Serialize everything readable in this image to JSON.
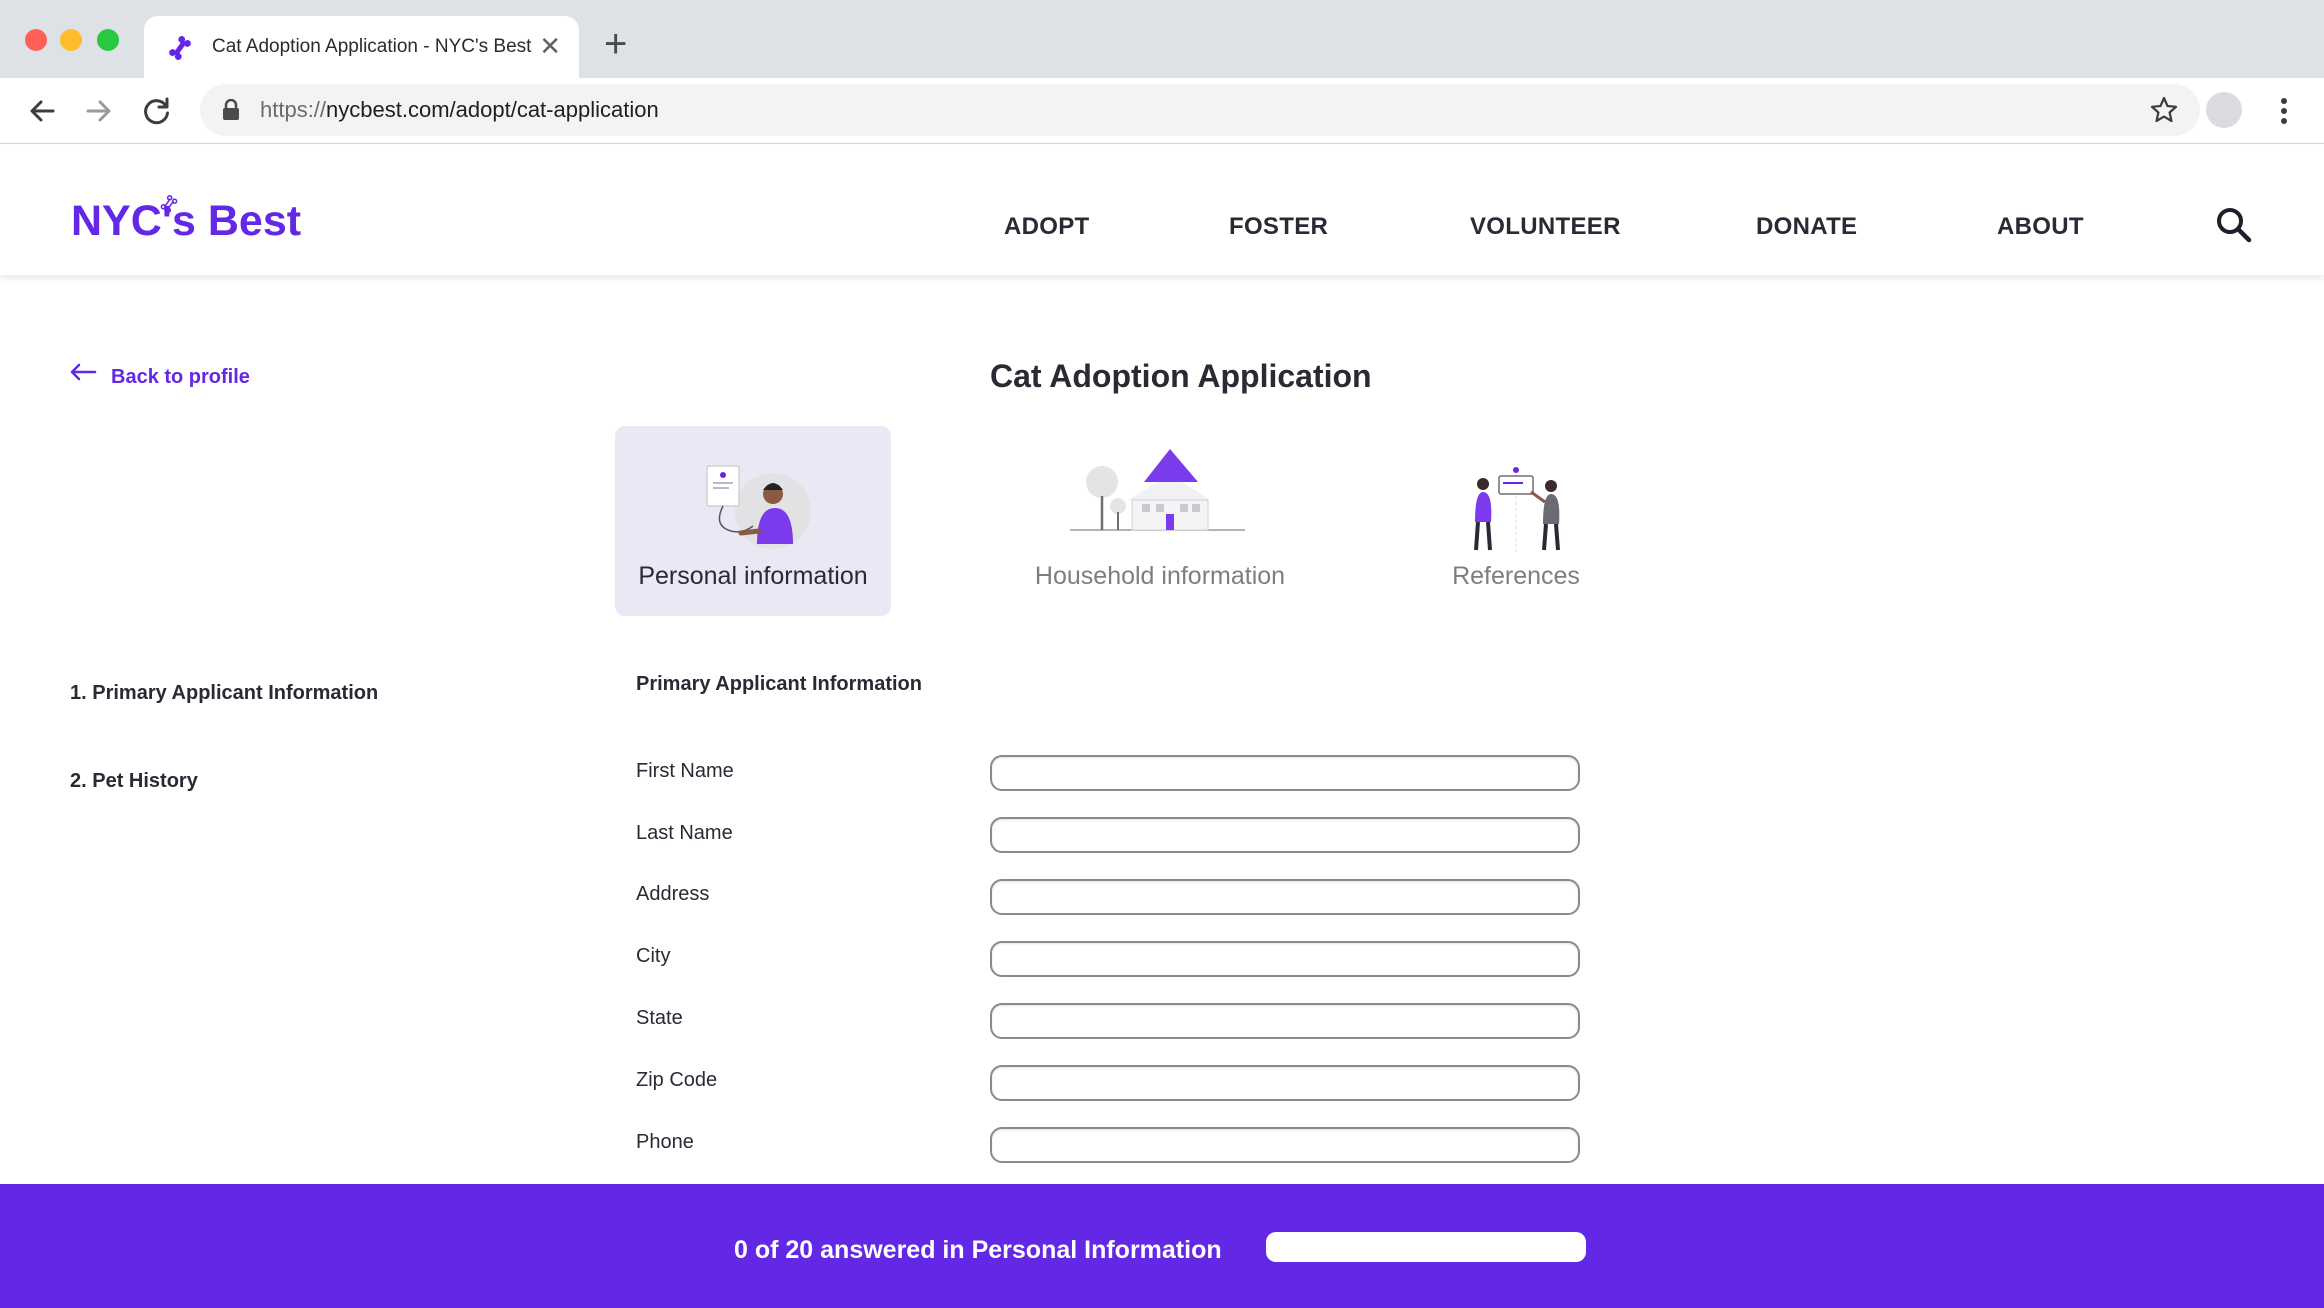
{
  "browser": {
    "tab_title": "Cat Adoption Application - NYC's Best",
    "url_scheme": "https://",
    "url_rest": "nycbest.com/adopt/cat-application",
    "icons": [
      "back-arrow-icon",
      "forward-arrow-icon",
      "reload-icon",
      "lock-icon",
      "star-icon",
      "more-menu-icon",
      "close-icon",
      "plus-icon"
    ]
  },
  "header": {
    "logo": "NYC's Best",
    "nav": [
      "ADOPT",
      "FOSTER",
      "VOLUNTEER",
      "DONATE",
      "ABOUT"
    ]
  },
  "back_link": "Back to profile",
  "page_title": "Cat Adoption Application",
  "steps": [
    {
      "label": "Personal information",
      "active": true
    },
    {
      "label": "Household information",
      "active": false
    },
    {
      "label": "References",
      "active": false
    }
  ],
  "side_nav": [
    "1. Primary Applicant Information",
    "2. Pet History"
  ],
  "form": {
    "section_heading": "Primary Applicant Information",
    "fields": [
      {
        "label": "First Name",
        "value": ""
      },
      {
        "label": "Last Name",
        "value": ""
      },
      {
        "label": "Address",
        "value": ""
      },
      {
        "label": "City",
        "value": ""
      },
      {
        "label": "State",
        "value": ""
      },
      {
        "label": "Zip Code",
        "value": ""
      },
      {
        "label": "Phone",
        "value": ""
      }
    ]
  },
  "progress": {
    "text": "0 of 20 answered in Personal Information",
    "answered": 0,
    "total": 20,
    "fraction": 0
  },
  "colors": {
    "brand_purple": "#6327e6",
    "active_step_bg": "#e9e9f6"
  }
}
